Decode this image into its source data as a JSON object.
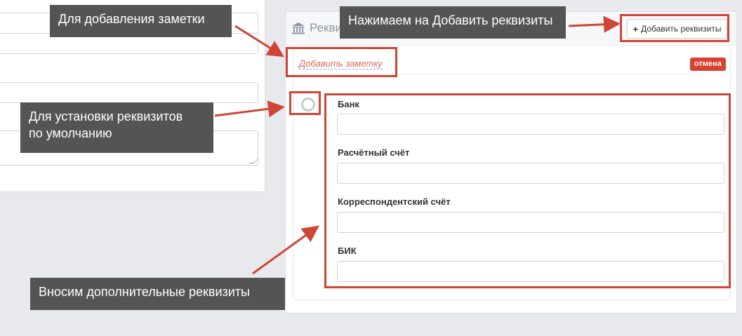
{
  "colors": {
    "accent_red": "#cf4536",
    "callout_bg": "#545454",
    "cancel_bg": "#d9412e",
    "link_color": "#e0685c"
  },
  "panel": {
    "title": "Реквизиты",
    "title_icon": "bank-icon",
    "add_button_label": "Добавить реквизиты",
    "add_button_icon": "plus-icon"
  },
  "note": {
    "add_note_label": "Добавить заметку",
    "cancel_label": "отмена"
  },
  "fields": [
    {
      "label": "Банк",
      "value": ""
    },
    {
      "label": "Расчётный счёт",
      "value": ""
    },
    {
      "label": "Корреспондентский счёт",
      "value": ""
    },
    {
      "label": "БИК",
      "value": ""
    }
  ],
  "annotations": {
    "add_note": "Для добавления заметки",
    "add_requisites": "Нажимаем на Добавить реквизиты",
    "default_line1": "Для установки реквизитов",
    "default_line2": "по умолчанию",
    "extra_requisites": "Вносим дополнительные реквизиты"
  }
}
